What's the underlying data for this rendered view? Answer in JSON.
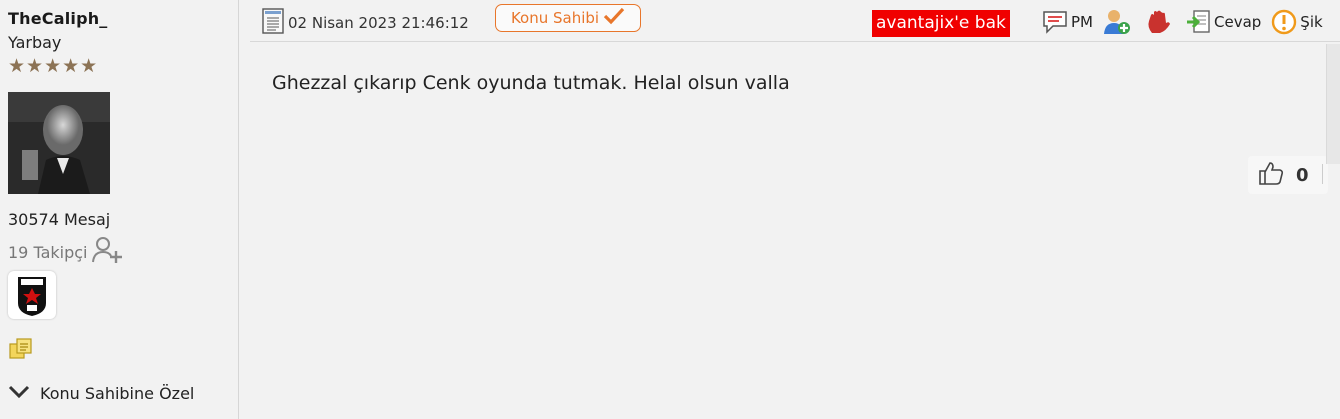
{
  "user": {
    "username": "TheCaliph_",
    "rank": "Yarbay",
    "stars": "★★★★★",
    "message_count": "30574 Mesaj",
    "followers": "19 Takipçi"
  },
  "sidebar": {
    "special_label": "Konu Sahibine Özel"
  },
  "post": {
    "date": "02 Nisan 2023 21:46:12",
    "owner_badge": "Konu Sahibi",
    "promo_label": "avantajix'e bak",
    "actions": {
      "pm": "PM",
      "reply": "Cevap",
      "complaint": "Şik"
    },
    "body": "Ghezzal çıkarıp Cenk oyunda tutmak. Helal olsun valla",
    "like_count": "0"
  },
  "colors": {
    "accent_orange": "#e8762b",
    "promo_red": "#f00000",
    "star": "#8c7355"
  }
}
